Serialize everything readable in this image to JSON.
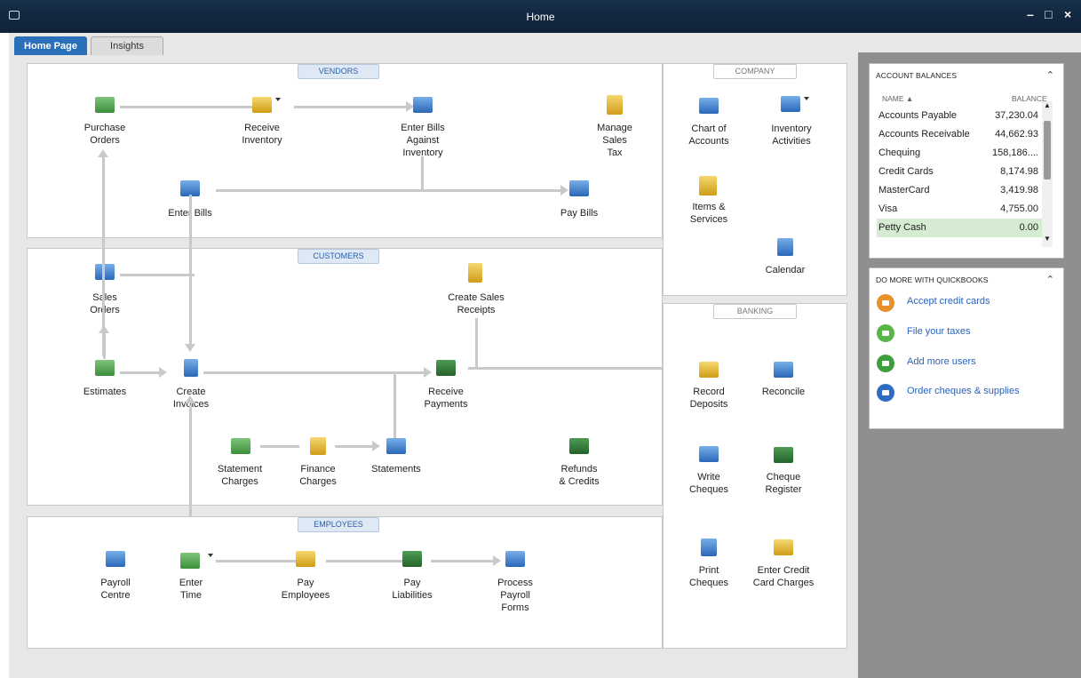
{
  "window": {
    "title": "Home",
    "minimize": "–",
    "maximize": "□",
    "close": "×"
  },
  "tabs": [
    {
      "label": "Home Page",
      "active": true
    },
    {
      "label": "Insights",
      "active": false
    }
  ],
  "vendors": {
    "label": "VENDORS",
    "purchase_orders": "Purchase\nOrders",
    "receive_inventory": "Receive\nInventory",
    "enter_bills_against_inventory": "Enter Bills\nAgainst\nInventory",
    "manage_sales_tax": "Manage\nSales\nTax",
    "enter_bills": "Enter Bills",
    "pay_bills": "Pay Bills"
  },
  "customers": {
    "label": "CUSTOMERS",
    "sales_orders": "Sales\nOrders",
    "create_sales_receipts": "Create Sales\nReceipts",
    "estimates": "Estimates",
    "create_invoices": "Create\nInvoices",
    "receive_payments": "Receive\nPayments",
    "statement_charges": "Statement\nCharges",
    "finance_charges": "Finance\nCharges",
    "statements": "Statements",
    "refunds_credits": "Refunds\n& Credits"
  },
  "employees": {
    "label": "EMPLOYEES",
    "payroll_centre": "Payroll\nCentre",
    "enter_time": "Enter\nTime",
    "pay_employees": "Pay\nEmployees",
    "pay_liabilities": "Pay\nLiabilities",
    "process_payroll_forms": "Process\nPayroll\nForms"
  },
  "company": {
    "label": "COMPANY",
    "chart_of_accounts": "Chart of\nAccounts",
    "inventory_activities": "Inventory\nActivities",
    "items_services": "Items &\nServices",
    "calendar": "Calendar"
  },
  "banking": {
    "label": "BANKING",
    "record_deposits": "Record\nDeposits",
    "reconcile": "Reconcile",
    "write_cheques": "Write\nCheques",
    "cheque_register": "Cheque\nRegister",
    "print_cheques": "Print\nCheques",
    "enter_credit_card_charges": "Enter Credit\nCard Charges"
  },
  "account_balances": {
    "title": "ACCOUNT BALANCES",
    "col_name": "NAME ▲",
    "col_balance": "BALANCE",
    "rows": [
      {
        "name": "Accounts Payable",
        "balance": "37,230.04"
      },
      {
        "name": "Accounts Receivable",
        "balance": "44,662.93"
      },
      {
        "name": "Chequing",
        "balance": "158,186...."
      },
      {
        "name": "Credit Cards",
        "balance": "8,174.98"
      },
      {
        "name": "MasterCard",
        "balance": "3,419.98"
      },
      {
        "name": "Visa",
        "balance": "4,755.00"
      },
      {
        "name": "Petty Cash",
        "balance": "0.00"
      }
    ]
  },
  "do_more": {
    "title": "DO MORE WITH QUICKBOOKS",
    "items": [
      {
        "label": "Accept credit cards",
        "color": "#e8902a"
      },
      {
        "label": "File your taxes",
        "color": "#59b548"
      },
      {
        "label": "Add more users",
        "color": "#3d9e3b"
      },
      {
        "label": "Order cheques & supplies",
        "color": "#2e6cc2"
      }
    ]
  }
}
